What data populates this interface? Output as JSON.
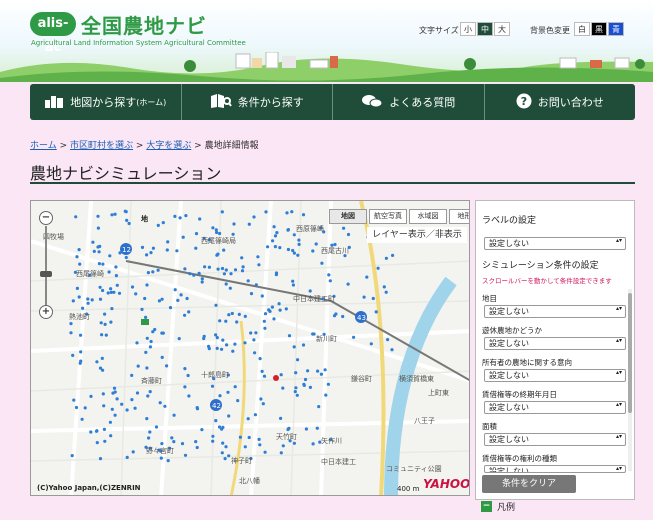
{
  "header": {
    "logo_badge": "alis-ac",
    "logo_title": "全国農地ナビ",
    "logo_sub": "Agricultural Land Information System Agricultural Committee",
    "font_size_label": "文字サイズ",
    "font_size_options": [
      "小",
      "中",
      "大"
    ],
    "font_size_selected": "中",
    "bg_label": "背景色変更",
    "bg_options": [
      "白",
      "黒",
      "青"
    ],
    "bg_selected": "青"
  },
  "nav": [
    {
      "label": "地図から探す",
      "suffix": "(ホーム)",
      "icon": "map-search-icon"
    },
    {
      "label": "条件から探す",
      "suffix": "",
      "icon": "book-search-icon"
    },
    {
      "label": "よくある質問",
      "suffix": "",
      "icon": "chat-bubbles-icon"
    },
    {
      "label": "お問い合わせ",
      "suffix": "",
      "icon": "question-icon"
    }
  ],
  "breadcrumb": {
    "items": [
      "ホーム",
      "市区町村を選ぶ",
      "大字を選ぶ"
    ],
    "current": "農地詳細情報",
    "sep": " > "
  },
  "page_title": "農地ナビシミュレーション",
  "map": {
    "tabs": [
      "地図",
      "航空写真",
      "水域図",
      "地形図"
    ],
    "active_tab": "地図",
    "layer_toggle": "レイヤー表示／非表示",
    "copyright": "(C)Yahoo Japan,(C)ZENRIN",
    "scale": "400 m",
    "brand": "YAHOO!",
    "labels": [
      "西原篠崎",
      "四牧場",
      "西尾篠崎",
      "西尾篠崎局",
      "熱池町",
      "斉藤町",
      "野々宮町",
      "十郎島町",
      "天竹町",
      "矢作川",
      "新川町",
      "鎌谷町",
      "上町東",
      "八王子",
      "中日本建工",
      "コミュニティ公園",
      "横須賀橋東",
      "西尾古川",
      "中日本建工町",
      "神子町",
      "北八幡"
    ],
    "route_labels": [
      "12",
      "42",
      "43"
    ],
    "store_label": "地"
  },
  "panel": {
    "label_heading": "ラベルの設定",
    "label_value": "設定しない",
    "sim_heading": "シミュレーション条件の設定",
    "sim_note": "スクロールバーを動かして条件設定できます",
    "fields": [
      {
        "label": "地目",
        "value": "設定しない"
      },
      {
        "label": "遊休農地かどうか",
        "value": "設定しない"
      },
      {
        "label": "所有者の農地に関する意向",
        "value": "設定しない"
      },
      {
        "label": "賃借権等の終期年月日",
        "value": "設定しない"
      },
      {
        "label": "面積",
        "value": "設定しない"
      },
      {
        "label": "賃借権等の権利の種類",
        "value": "設定しない"
      }
    ],
    "clear_button": "条件をクリア"
  },
  "legend": {
    "label": "凡例",
    "toggle": "−"
  },
  "colors": {
    "brand_green": "#2f9a45",
    "nav_bg": "#1f4d3a",
    "page_bg": "#fbe6f5",
    "link": "#1a5fb4",
    "note_red": "#d0145a",
    "map_dot": "#2e7ed6"
  }
}
